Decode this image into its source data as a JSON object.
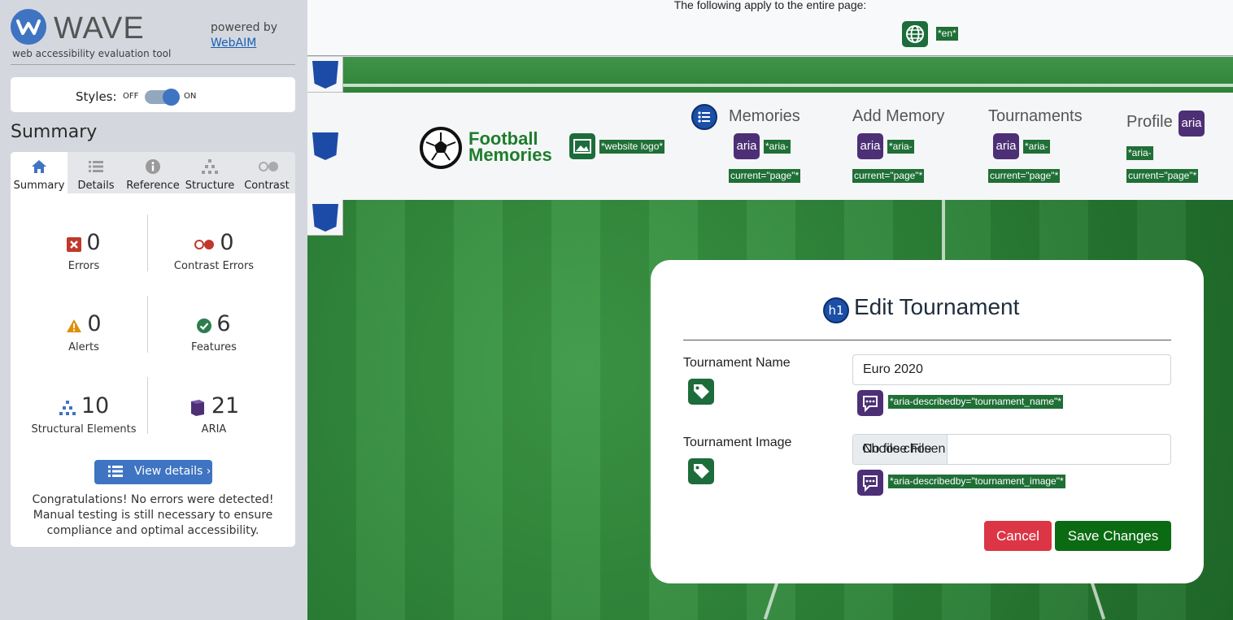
{
  "wave": {
    "brand": "WAVE",
    "tagline": "web accessibility evaluation tool",
    "powered_by": "powered by",
    "webaim_link": "WebAIM",
    "styles_label": "Styles:",
    "styles_off": "OFF",
    "styles_on": "ON",
    "styles_enabled": true,
    "summary_title": "Summary",
    "tabs": [
      {
        "label": "Summary",
        "icon": "home-icon",
        "active": true
      },
      {
        "label": "Details",
        "icon": "list-icon",
        "active": false
      },
      {
        "label": "Reference",
        "icon": "info-icon",
        "active": false
      },
      {
        "label": "Structure",
        "icon": "structure-icon",
        "active": false
      },
      {
        "label": "Contrast",
        "icon": "contrast-icon",
        "active": false
      }
    ],
    "stats": {
      "errors": {
        "count": "0",
        "label": "Errors",
        "color": "#c0392b"
      },
      "contrast_errors": {
        "count": "0",
        "label": "Contrast Errors",
        "color": "#c0392b"
      },
      "alerts": {
        "count": "0",
        "label": "Alerts",
        "color": "#e08e0b"
      },
      "features": {
        "count": "6",
        "label": "Features",
        "color": "#2e7d4f"
      },
      "structural": {
        "count": "10",
        "label": "Structural Elements",
        "color": "#3f74c2"
      },
      "aria": {
        "count": "21",
        "label": "ARIA",
        "color": "#4d2f76"
      }
    },
    "view_details": "View details ›",
    "congrats": "Congratulations! No errors were detected! Manual testing is still necessary to ensure compliance and optimal accessibility."
  },
  "page": {
    "banner_text": "The following apply to the entire page:",
    "lang_tag": "*en*",
    "logo_alt_tag": "*website logo*",
    "brand_line1": "Football",
    "brand_line2": "Memories",
    "nav": [
      {
        "label": "Memories",
        "aria_tag_1": "*aria-",
        "aria_tag_2": "current=\"page\"*"
      },
      {
        "label": "Add Memory",
        "aria_tag_1": "*aria-",
        "aria_tag_2": "current=\"page\"*"
      },
      {
        "label": "Tournaments",
        "aria_tag_1": "*aria-",
        "aria_tag_2": "current=\"page\"*"
      },
      {
        "label": "Profile",
        "aria_tag_1": "*aria-",
        "aria_tag_2": "current=\"page\"*"
      }
    ],
    "aria_icon_text": "aria",
    "form": {
      "h1_badge": "h1",
      "title": "Edit Tournament",
      "name_label": "Tournament Name",
      "name_value": "Euro 2020",
      "name_describedby": "*aria-describedby=\"tournament_name\"*",
      "image_label": "Tournament Image",
      "choose_file": "Choose File",
      "no_file": "No file chosen",
      "image_describedby": "*aria-describedby=\"tournament_image\"*",
      "cancel": "Cancel",
      "save": "Save Changes"
    }
  }
}
